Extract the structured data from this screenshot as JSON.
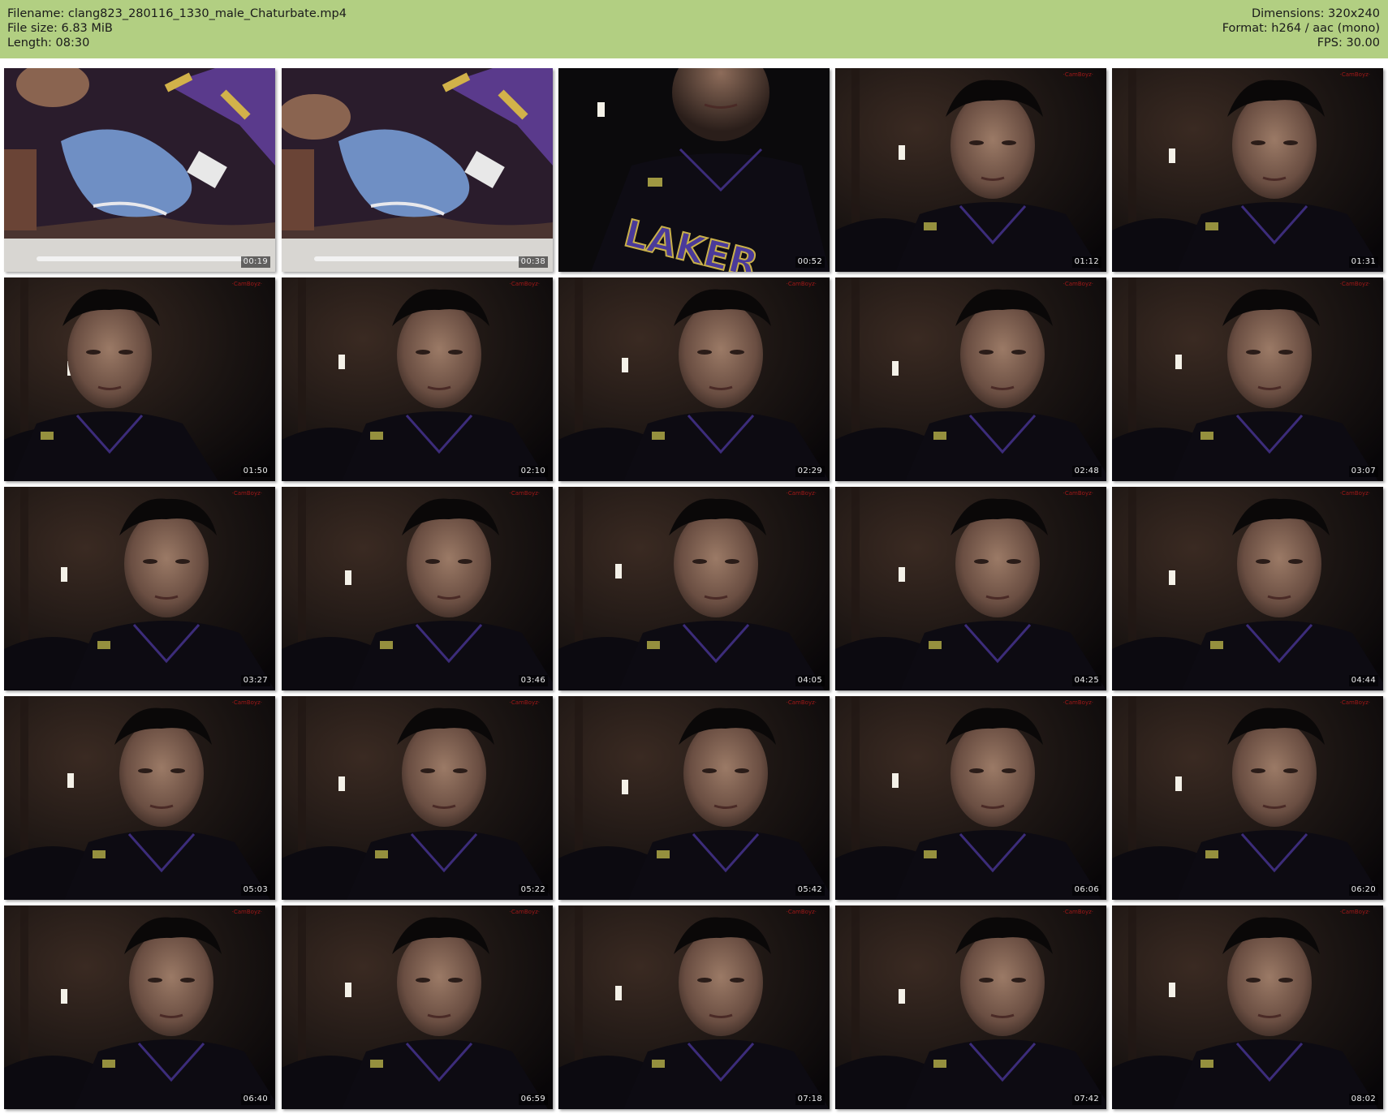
{
  "header": {
    "filename": "Filename: clang823_280116_1330_male_Chaturbate.mp4",
    "filesize": "File size: 6.83 MiB",
    "length": "Length: 08:30",
    "dimensions": "Dimensions: 320x240",
    "format": "Format: h264 / aac (mono)",
    "fps": "FPS: 30.00"
  },
  "colors": {
    "header_bg": "#b2cf82",
    "page_bg": "#ffffff"
  },
  "thumbnails": [
    {
      "time": "00:19",
      "scene": "laptop-shorts"
    },
    {
      "time": "00:38",
      "scene": "laptop-shorts"
    },
    {
      "time": "00:52",
      "scene": "person-closeup"
    },
    {
      "time": "01:12",
      "scene": "person"
    },
    {
      "time": "01:31",
      "scene": "person"
    },
    {
      "time": "01:50",
      "scene": "person-left"
    },
    {
      "time": "02:10",
      "scene": "person"
    },
    {
      "time": "02:29",
      "scene": "person"
    },
    {
      "time": "02:48",
      "scene": "person"
    },
    {
      "time": "03:07",
      "scene": "person"
    },
    {
      "time": "03:27",
      "scene": "person"
    },
    {
      "time": "03:46",
      "scene": "person"
    },
    {
      "time": "04:05",
      "scene": "person"
    },
    {
      "time": "04:25",
      "scene": "person"
    },
    {
      "time": "04:44",
      "scene": "person"
    },
    {
      "time": "05:03",
      "scene": "person"
    },
    {
      "time": "05:22",
      "scene": "person"
    },
    {
      "time": "05:42",
      "scene": "person"
    },
    {
      "time": "06:06",
      "scene": "person"
    },
    {
      "time": "06:20",
      "scene": "person"
    },
    {
      "time": "06:40",
      "scene": "person"
    },
    {
      "time": "06:59",
      "scene": "person"
    },
    {
      "time": "07:18",
      "scene": "person"
    },
    {
      "time": "07:42",
      "scene": "person"
    },
    {
      "time": "08:02",
      "scene": "person"
    }
  ]
}
